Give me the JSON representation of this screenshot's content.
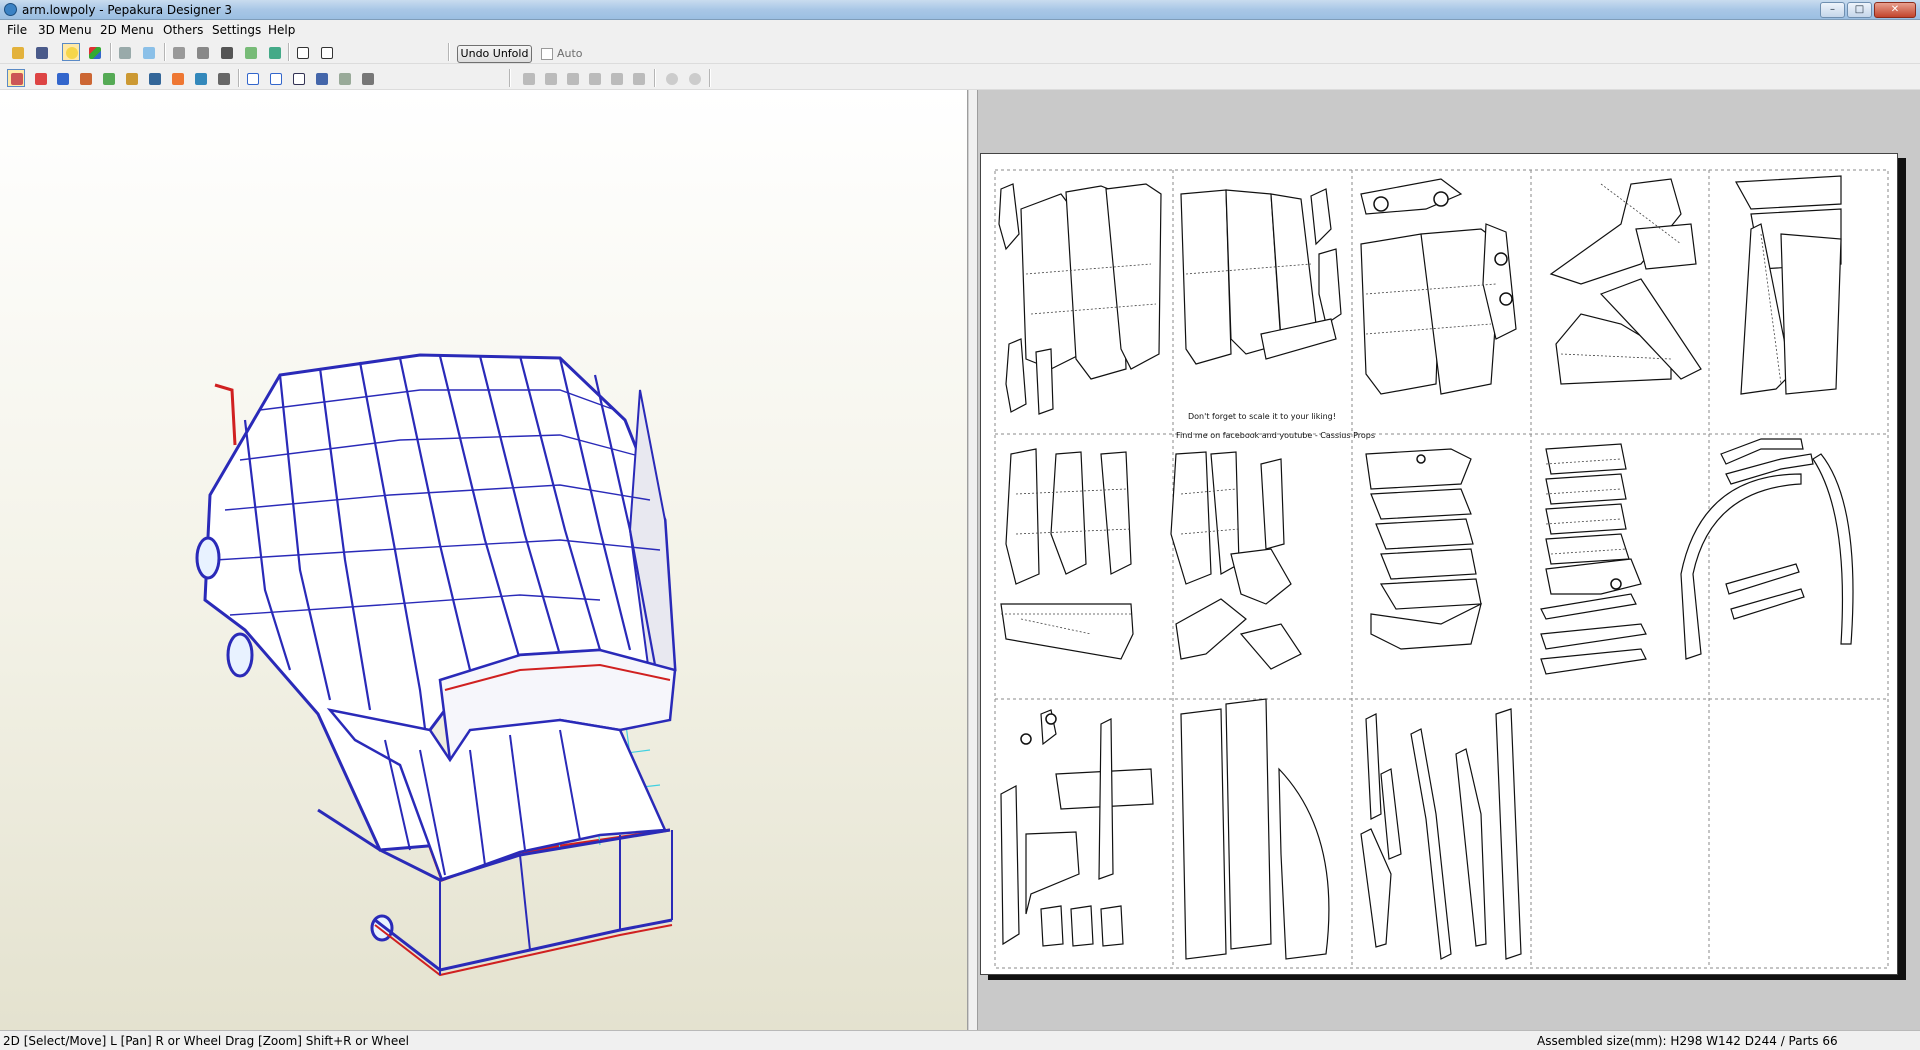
{
  "window": {
    "title": "arm.lowpoly - Pepakura Designer 3",
    "minimize_glyph": "–",
    "maximize_glyph": "□",
    "close_glyph": "✕"
  },
  "menu": [
    {
      "label": "File"
    },
    {
      "label": "3D Menu"
    },
    {
      "label": "2D Menu"
    },
    {
      "label": "Others"
    },
    {
      "label": "Settings"
    },
    {
      "label": "Help"
    }
  ],
  "toolbar": {
    "undo_unfold_label": "Undo Unfold",
    "auto_label": "Auto",
    "auto_checked": false,
    "row1_icons": [
      "open-icon",
      "save-icon",
      "lightbulb-icon",
      "texture-icon",
      "cube-icon",
      "rotate-icon",
      "edge-icon",
      "anchor-icon",
      "pages-icon",
      "export-icon",
      "single-pane-icon",
      "dual-pane-icon"
    ],
    "row2_icons": [
      "select-move-icon",
      "edit-flap-icon",
      "paper-size-icon",
      "join-icon",
      "flap-icon",
      "length-icon",
      "image-icon",
      "color-icon",
      "undo-icon",
      "redo-icon",
      "fit-icon",
      "arrange-icon",
      "page-one-icon",
      "layout-icon",
      "print-setup-icon",
      "print-icon",
      "align-left-icon",
      "align-center-icon",
      "align-right-icon",
      "align-top-icon",
      "align-middle-icon",
      "align-bottom-icon",
      "rotate-ccw-90-icon",
      "rotate-cw-90-icon"
    ]
  },
  "paper": {
    "note_line1": "Don't forget to scale it to your liking!",
    "note_line2": "Find me on facebook and youtube - Cassius Props"
  },
  "status": {
    "mode_text": "2D [Select/Move] L [Pan] R or Wheel Drag [Zoom] Shift+R or Wheel",
    "assembly_text": "Assembled size(mm): H298 W142 D244 / Parts 66"
  },
  "colors": {
    "model_edge": "#2a2ab8",
    "cut_edge": "#d02020",
    "inner_fold": "#40d0e0",
    "selected_tool": "#ffe9a8"
  }
}
